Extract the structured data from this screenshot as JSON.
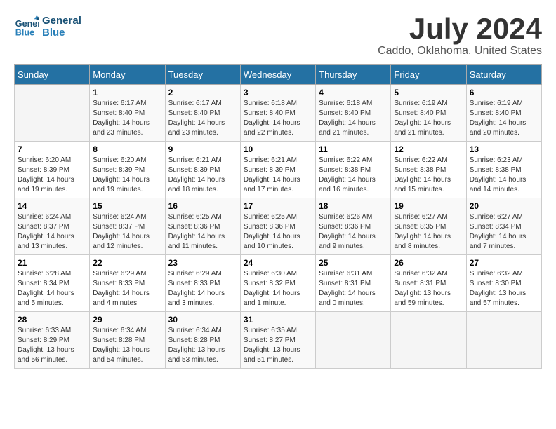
{
  "header": {
    "logo_line1": "General",
    "logo_line2": "Blue",
    "month": "July 2024",
    "location": "Caddo, Oklahoma, United States"
  },
  "weekdays": [
    "Sunday",
    "Monday",
    "Tuesday",
    "Wednesday",
    "Thursday",
    "Friday",
    "Saturday"
  ],
  "weeks": [
    [
      {
        "day": "",
        "content": ""
      },
      {
        "day": "1",
        "content": "Sunrise: 6:17 AM\nSunset: 8:40 PM\nDaylight: 14 hours\nand 23 minutes."
      },
      {
        "day": "2",
        "content": "Sunrise: 6:17 AM\nSunset: 8:40 PM\nDaylight: 14 hours\nand 23 minutes."
      },
      {
        "day": "3",
        "content": "Sunrise: 6:18 AM\nSunset: 8:40 PM\nDaylight: 14 hours\nand 22 minutes."
      },
      {
        "day": "4",
        "content": "Sunrise: 6:18 AM\nSunset: 8:40 PM\nDaylight: 14 hours\nand 21 minutes."
      },
      {
        "day": "5",
        "content": "Sunrise: 6:19 AM\nSunset: 8:40 PM\nDaylight: 14 hours\nand 21 minutes."
      },
      {
        "day": "6",
        "content": "Sunrise: 6:19 AM\nSunset: 8:40 PM\nDaylight: 14 hours\nand 20 minutes."
      }
    ],
    [
      {
        "day": "7",
        "content": "Sunrise: 6:20 AM\nSunset: 8:39 PM\nDaylight: 14 hours\nand 19 minutes."
      },
      {
        "day": "8",
        "content": "Sunrise: 6:20 AM\nSunset: 8:39 PM\nDaylight: 14 hours\nand 19 minutes."
      },
      {
        "day": "9",
        "content": "Sunrise: 6:21 AM\nSunset: 8:39 PM\nDaylight: 14 hours\nand 18 minutes."
      },
      {
        "day": "10",
        "content": "Sunrise: 6:21 AM\nSunset: 8:39 PM\nDaylight: 14 hours\nand 17 minutes."
      },
      {
        "day": "11",
        "content": "Sunrise: 6:22 AM\nSunset: 8:38 PM\nDaylight: 14 hours\nand 16 minutes."
      },
      {
        "day": "12",
        "content": "Sunrise: 6:22 AM\nSunset: 8:38 PM\nDaylight: 14 hours\nand 15 minutes."
      },
      {
        "day": "13",
        "content": "Sunrise: 6:23 AM\nSunset: 8:38 PM\nDaylight: 14 hours\nand 14 minutes."
      }
    ],
    [
      {
        "day": "14",
        "content": "Sunrise: 6:24 AM\nSunset: 8:37 PM\nDaylight: 14 hours\nand 13 minutes."
      },
      {
        "day": "15",
        "content": "Sunrise: 6:24 AM\nSunset: 8:37 PM\nDaylight: 14 hours\nand 12 minutes."
      },
      {
        "day": "16",
        "content": "Sunrise: 6:25 AM\nSunset: 8:36 PM\nDaylight: 14 hours\nand 11 minutes."
      },
      {
        "day": "17",
        "content": "Sunrise: 6:25 AM\nSunset: 8:36 PM\nDaylight: 14 hours\nand 10 minutes."
      },
      {
        "day": "18",
        "content": "Sunrise: 6:26 AM\nSunset: 8:36 PM\nDaylight: 14 hours\nand 9 minutes."
      },
      {
        "day": "19",
        "content": "Sunrise: 6:27 AM\nSunset: 8:35 PM\nDaylight: 14 hours\nand 8 minutes."
      },
      {
        "day": "20",
        "content": "Sunrise: 6:27 AM\nSunset: 8:34 PM\nDaylight: 14 hours\nand 7 minutes."
      }
    ],
    [
      {
        "day": "21",
        "content": "Sunrise: 6:28 AM\nSunset: 8:34 PM\nDaylight: 14 hours\nand 5 minutes."
      },
      {
        "day": "22",
        "content": "Sunrise: 6:29 AM\nSunset: 8:33 PM\nDaylight: 14 hours\nand 4 minutes."
      },
      {
        "day": "23",
        "content": "Sunrise: 6:29 AM\nSunset: 8:33 PM\nDaylight: 14 hours\nand 3 minutes."
      },
      {
        "day": "24",
        "content": "Sunrise: 6:30 AM\nSunset: 8:32 PM\nDaylight: 14 hours\nand 1 minute."
      },
      {
        "day": "25",
        "content": "Sunrise: 6:31 AM\nSunset: 8:31 PM\nDaylight: 14 hours\nand 0 minutes."
      },
      {
        "day": "26",
        "content": "Sunrise: 6:32 AM\nSunset: 8:31 PM\nDaylight: 13 hours\nand 59 minutes."
      },
      {
        "day": "27",
        "content": "Sunrise: 6:32 AM\nSunset: 8:30 PM\nDaylight: 13 hours\nand 57 minutes."
      }
    ],
    [
      {
        "day": "28",
        "content": "Sunrise: 6:33 AM\nSunset: 8:29 PM\nDaylight: 13 hours\nand 56 minutes."
      },
      {
        "day": "29",
        "content": "Sunrise: 6:34 AM\nSunset: 8:28 PM\nDaylight: 13 hours\nand 54 minutes."
      },
      {
        "day": "30",
        "content": "Sunrise: 6:34 AM\nSunset: 8:28 PM\nDaylight: 13 hours\nand 53 minutes."
      },
      {
        "day": "31",
        "content": "Sunrise: 6:35 AM\nSunset: 8:27 PM\nDaylight: 13 hours\nand 51 minutes."
      },
      {
        "day": "",
        "content": ""
      },
      {
        "day": "",
        "content": ""
      },
      {
        "day": "",
        "content": ""
      }
    ]
  ]
}
